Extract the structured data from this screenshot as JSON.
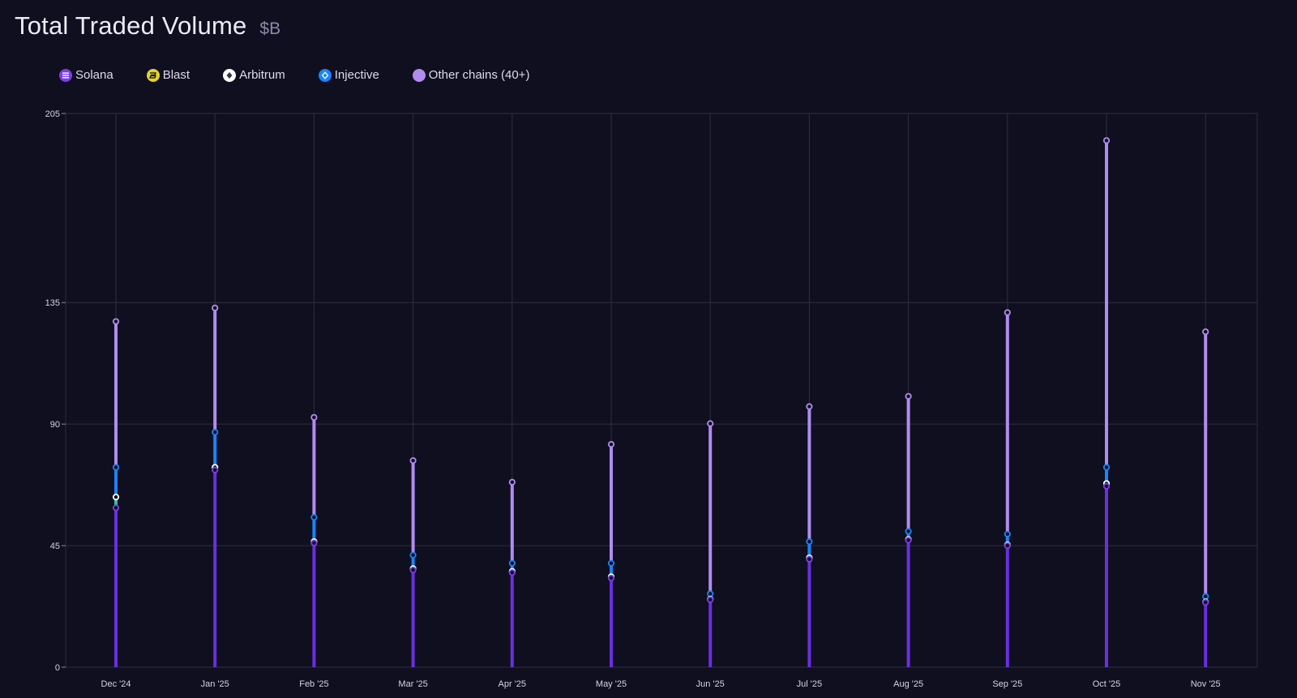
{
  "title": "Total Traded Volume",
  "unit": "$B",
  "legend": [
    {
      "label": "Solana",
      "icon": "solana-icon",
      "color": "#7b3fe4"
    },
    {
      "label": "Blast",
      "icon": "blast-icon",
      "color": "#e3d230"
    },
    {
      "label": "Arbitrum",
      "icon": "arbitrum-icon",
      "color": "#ffffff"
    },
    {
      "label": "Injective",
      "icon": "injective-icon",
      "color": "#1a84ff"
    },
    {
      "label": "Other chains (40+)",
      "icon": "other-chains-icon",
      "color": "#b08cf0"
    }
  ],
  "chart_data": {
    "type": "bar",
    "stacked": true,
    "ylim": [
      0,
      205
    ],
    "yticks": [
      0,
      45,
      90,
      135,
      205
    ],
    "grid": true,
    "legend_position": "top-left",
    "categories": [
      "Dec '24",
      "Jan '25",
      "Feb '25",
      "Mar '25",
      "Apr '25",
      "May '25",
      "Jun '25",
      "Jul '25",
      "Aug '25",
      "Sep '25",
      "Oct '25",
      "Nov '25"
    ],
    "series": [
      {
        "name": "Solana",
        "color": "#6a2fe0",
        "values": [
          59,
          73,
          46,
          36,
          35,
          33,
          25,
          40,
          47,
          45,
          67,
          24
        ]
      },
      {
        "name": "Blast",
        "color": "#e3d230",
        "values": [
          0,
          0,
          0,
          0,
          0,
          0,
          0,
          0,
          0,
          0,
          0,
          0
        ]
      },
      {
        "name": "Arbitrum",
        "color": "#ffffff",
        "values": [
          4,
          1,
          0.5,
          0.5,
          0.5,
          0.5,
          0.2,
          0.5,
          0.3,
          0.3,
          1,
          0.2
        ]
      },
      {
        "name": "Injective",
        "color": "#1a84ff",
        "values": [
          11,
          13,
          9,
          5,
          3,
          5,
          2,
          6,
          3,
          4,
          6,
          2
        ]
      },
      {
        "name": "Other chains (40+)",
        "color": "#b08cf0",
        "values": [
          54,
          46,
          37,
          35,
          30,
          44,
          63,
          50,
          50,
          82,
          121,
          98
        ]
      }
    ],
    "segment_colors": [
      "#6a2fe0",
      "#e3d230",
      "#2bc39a",
      "#1a84ff",
      "#b08cf0"
    ],
    "marker_colors": [
      "#7b3fe4",
      "#e3d230",
      "#ffffff",
      "#1a84ff",
      "#b08cf0"
    ]
  }
}
